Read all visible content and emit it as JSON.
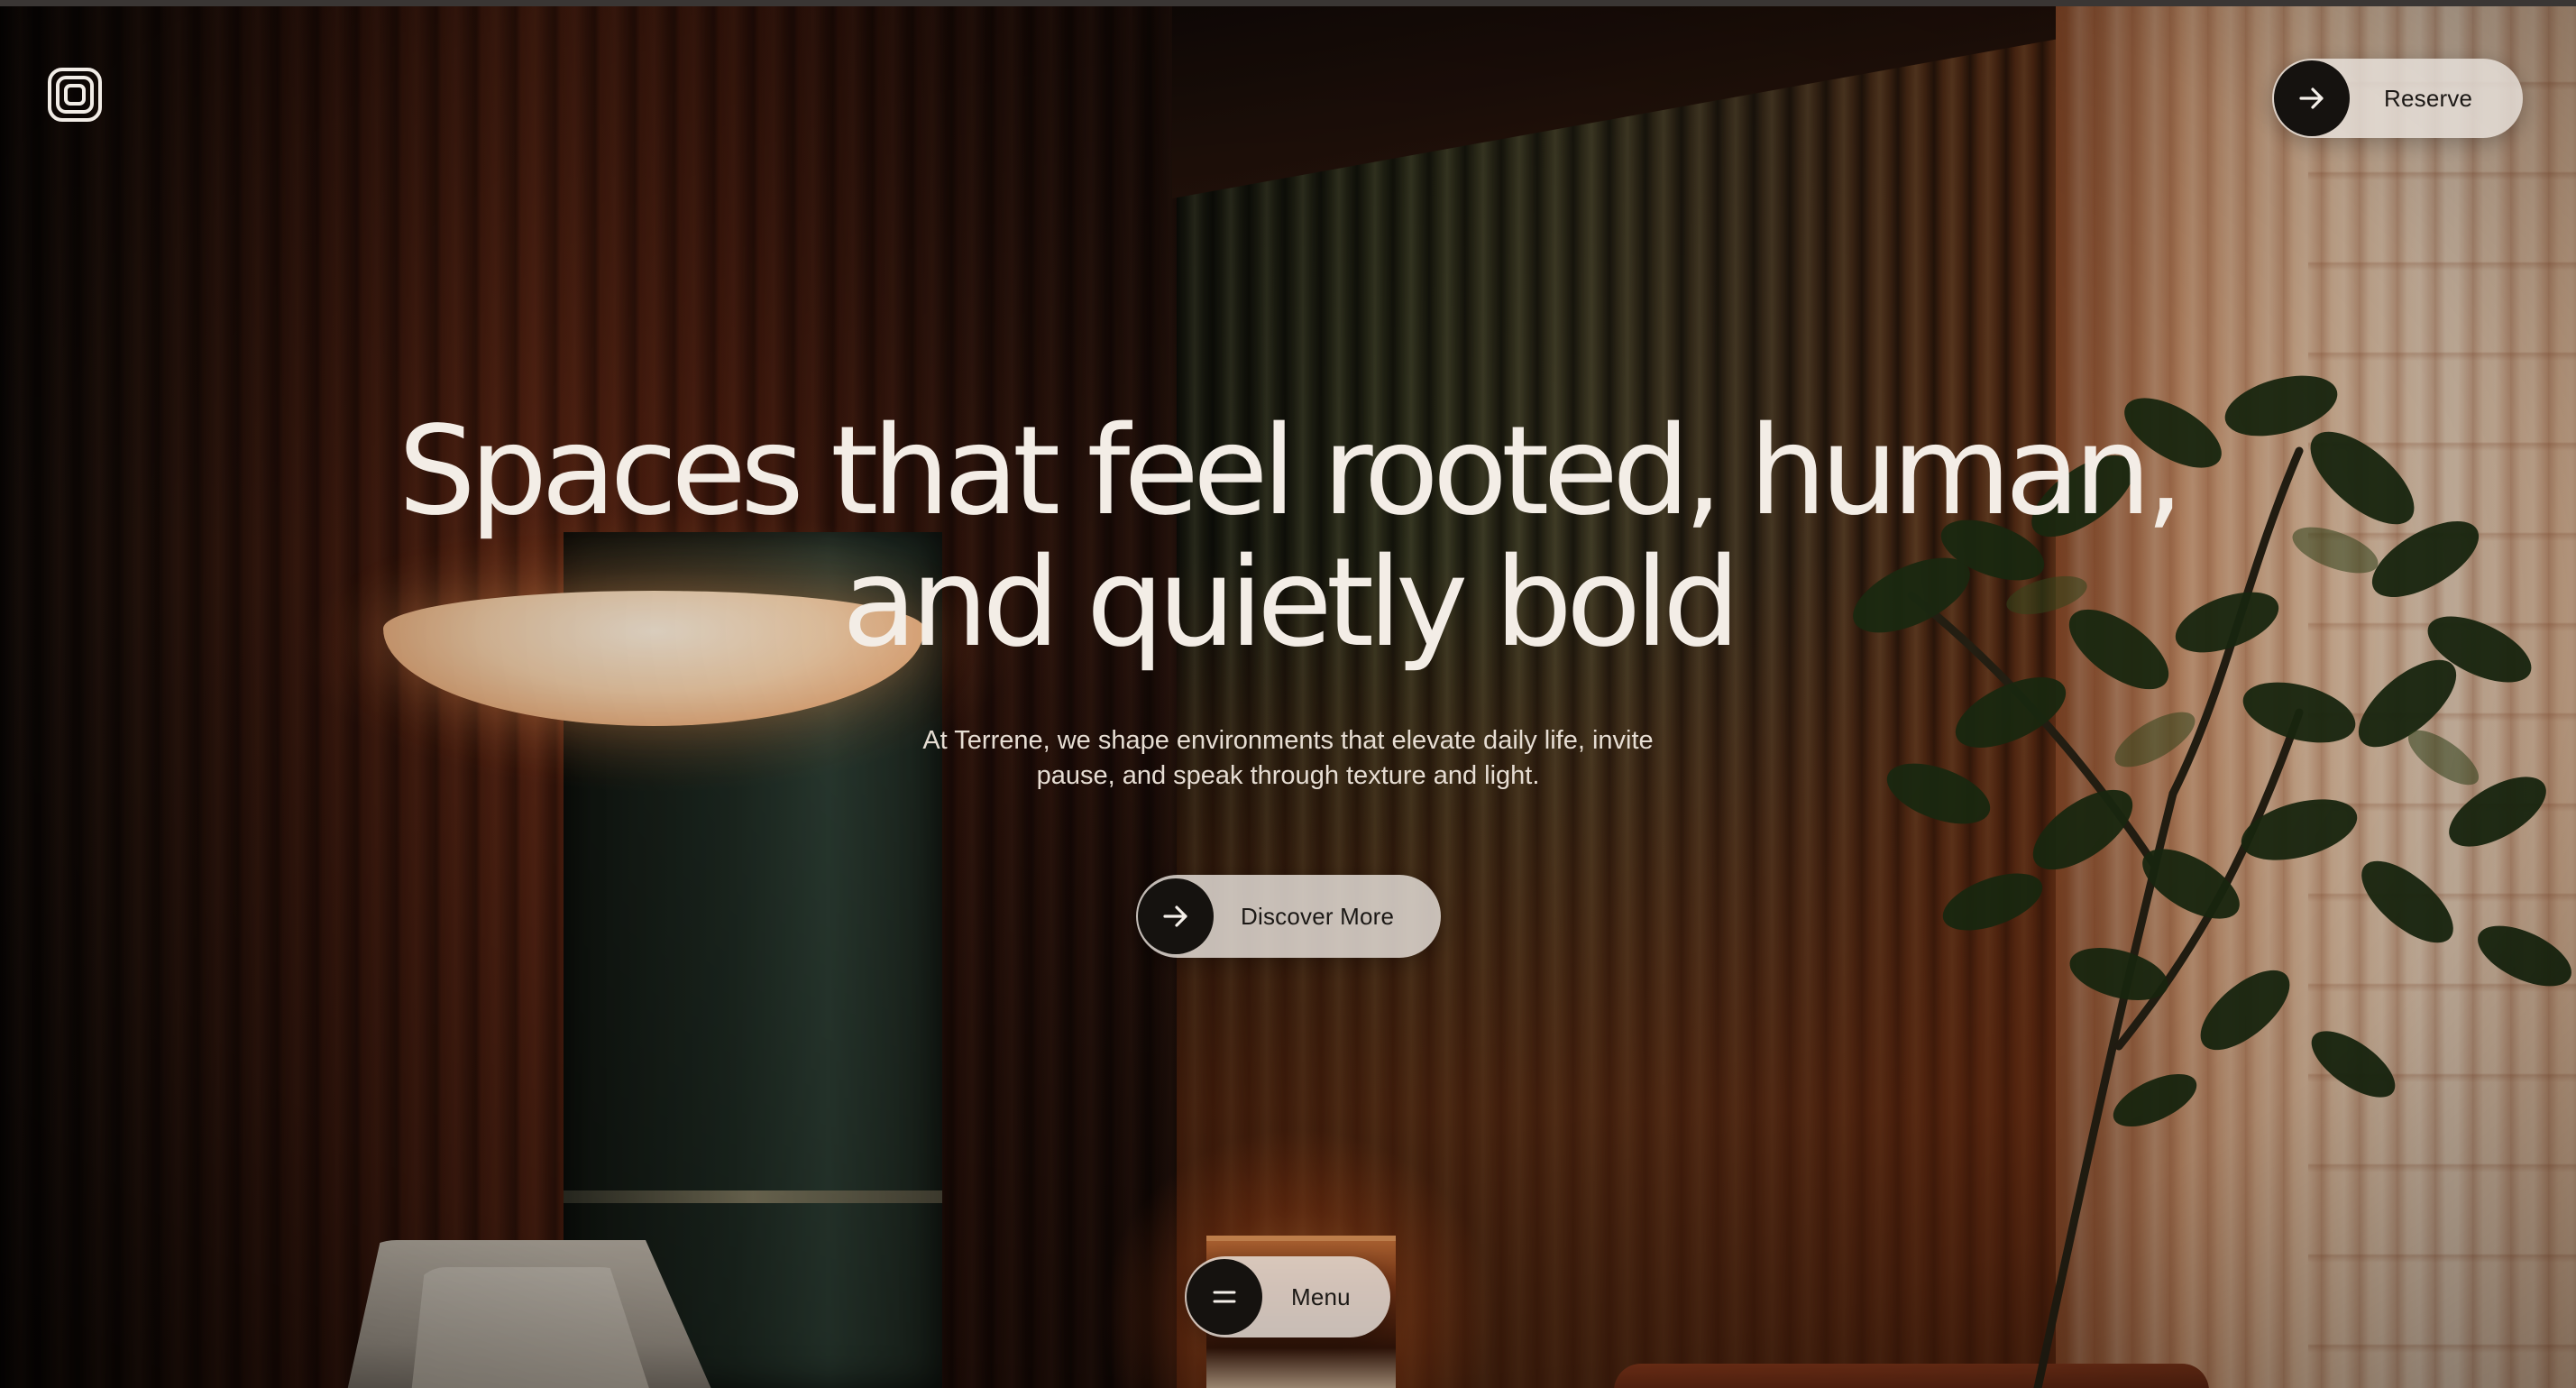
{
  "logo": {
    "icon": "concentric-square-logo-icon"
  },
  "header": {
    "reserve_label": "Reserve",
    "reserve_icon": "arrow-right-icon"
  },
  "hero": {
    "headline_line1": "Spaces that feel rooted, human,",
    "headline_line2": "and quietly bold",
    "subtext_line1": "At Terrene, we shape environments that elevate daily life, invite",
    "subtext_line2": "pause, and speak through texture and light.",
    "cta_label": "Discover More",
    "cta_icon": "arrow-right-icon"
  },
  "footer": {
    "menu_label": "Menu",
    "menu_icon": "menu-icon"
  },
  "colors": {
    "pill_background": "#e8e2dc",
    "pill_icon_circle": "#15120f",
    "headline_text": "#f3ede6",
    "body_text": "#e6ddd3"
  }
}
